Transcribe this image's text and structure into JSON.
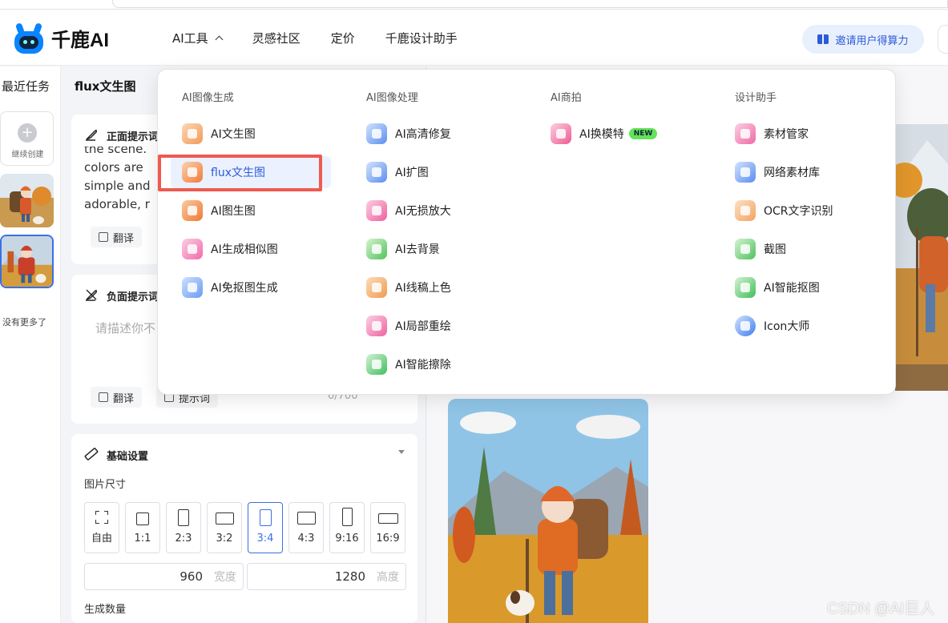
{
  "header": {
    "logo_text": "千鹿AI",
    "nav": [
      {
        "label": "AI工具"
      },
      {
        "label": "灵感社区"
      },
      {
        "label": "定价"
      },
      {
        "label": "千鹿设计助手"
      }
    ],
    "invite_label": "邀请用户得算力"
  },
  "recent": {
    "title": "最近任务",
    "continue_label": "继续创建",
    "no_more": "没有更多了"
  },
  "panel": {
    "title": "flux文生图",
    "positive": {
      "title": "正面提示词",
      "text": "the scene. The colors are simple and adorable, r",
      "lines": [
        "the scene.",
        "colors are",
        "simple and",
        "adorable, r"
      ],
      "translate_label": "翻译"
    },
    "negative": {
      "title": "负面提示词",
      "placeholder": "请描述你不",
      "translate_label": "翻译",
      "prompt_label": "提示词",
      "count": "0/700"
    },
    "base": {
      "title": "基础设置",
      "size_label": "图片尺寸",
      "ratios": [
        "自由",
        "1:1",
        "2:3",
        "3:2",
        "3:4",
        "4:3",
        "9:16",
        "16:9"
      ],
      "active_ratio": "3:4",
      "width_value": "960",
      "width_unit": "宽度",
      "height_value": "1280",
      "height_unit": "高度",
      "count_label": "生成数量"
    }
  },
  "menu": {
    "columns": [
      {
        "heading": "AI图像生成",
        "items": [
          "AI文生图",
          "flux文生图",
          "AI图生图",
          "AI生成相似图",
          "AI免抠图生成"
        ]
      },
      {
        "heading": "AI图像处理",
        "items": [
          "AI高清修复",
          "AI扩图",
          "AI无损放大",
          "AI去背景",
          "AI线稿上色",
          "AI局部重绘",
          "AI智能擦除"
        ]
      },
      {
        "heading": "AI商拍",
        "items": [
          "AI换模特"
        ],
        "badge": "NEW"
      },
      {
        "heading": "设计助手",
        "items": [
          "素材管家",
          "网络素材库",
          "OCR文字识别",
          "截图",
          "AI智能抠图",
          "Icon大师"
        ]
      }
    ],
    "selected_item": "flux文生图"
  },
  "watermark": "CSDN @AI巨人",
  "colors": {
    "accent": "#3b6fe6",
    "highlight_box": "#ef5a50",
    "new_badge": "#63e35a"
  }
}
